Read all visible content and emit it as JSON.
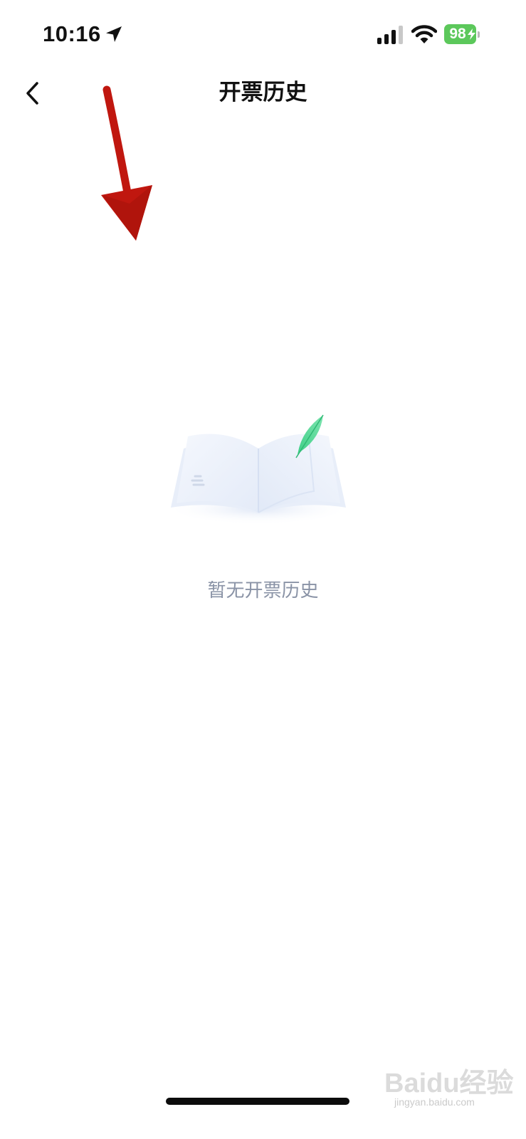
{
  "status_bar": {
    "time": "10:16",
    "battery_level": "98",
    "battery_color": "#5cc85b",
    "icons": [
      "location-arrow-icon",
      "cellular-signal-icon",
      "wifi-icon",
      "battery-charging-icon"
    ]
  },
  "nav": {
    "back_icon": "chevron-left-icon",
    "title": "开票历史"
  },
  "empty_state": {
    "illustration": "open-book-with-quill-illustration",
    "message": "暂无开票历史",
    "message_color": "#8a93a6"
  },
  "annotation": {
    "icon": "red-arrow-annotation",
    "color": "#c0170f"
  },
  "watermark": {
    "logo": "Baidu经验",
    "url": "jingyan.baidu.com"
  }
}
